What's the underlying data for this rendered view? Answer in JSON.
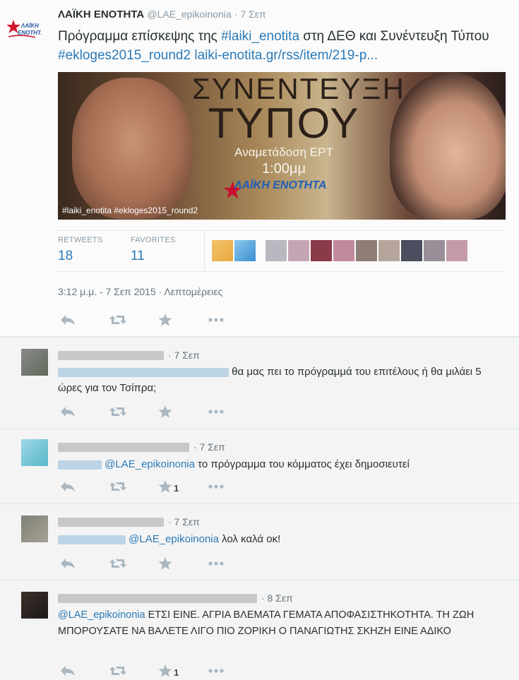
{
  "main": {
    "name": "ΛΑΪΚΗ ΕΝΟΤΗΤΑ",
    "handle": "@LAE_epikoinonia",
    "time": "· 7 Σεπ",
    "text_a": "Πρόγραμμα επίσκεψης της ",
    "hashtag1": "#laiki_enotita",
    "text_b": " στη ΔΕΘ και Συνέντευξη Τύπου ",
    "hashtag2": "#ekloges2015_round2",
    "link": " laiki-enotita.gr/rss/item/219-p...",
    "media": {
      "title1": "ΣΥΝΕΝΤΕΥΞΗ",
      "title2": "ΤΥΠΟΥ",
      "sub1": "Αναμετάδοση ΕΡΤ",
      "sub2": "1:00μμ",
      "logo": "ΛΑΪΚΗ ΕΝΟΤΗΤΑ",
      "tags": "#laiki_enotita #ekloges2015_round2"
    },
    "stats": {
      "retweets_label": "RETWEETS",
      "retweets": "18",
      "favorites_label": "FAVORITES",
      "favorites": "11"
    },
    "timestamp": "3:12 μ.μ. - 7 Σεπ 2015 · Λεπτομέρειες"
  },
  "replies": [
    {
      "time": "· 7 Σεπ",
      "text": "θα μας πει το πρόγραμμά του επιτέλους ή θα μιλάει 5 ώρες για τον Τσίπρα;",
      "fav_count": ""
    },
    {
      "time": "· 7 Σεπ",
      "mention": "@LAE_epikoinonia",
      "text": " το πρόγραμμα του κόμματος έχει δημοσιευτεί",
      "fav_count": "1"
    },
    {
      "time": "· 7 Σεπ",
      "mention": "@LAE_epikoinonia",
      "text": " λολ καλά οκ!",
      "fav_count": ""
    },
    {
      "time": "· 8 Σεπ",
      "mention": "@LAE_epikoinonia",
      "text": " ΕΤΣΙ ΕΙΝΕ. ΑΓΡΙΑ ΒΛΕΜΑΤΑ ΓΕΜΑΤΑ ΑΠΟΦΑΣΙΣΤΗΚΟΤΗΤΑ. ΤΗ ΖΩΗ ΜΠΟΡΟΥΣΑΤΕ ΝΑ ΒΑΛΕΤΕ ΛΙΓΟ ΠΙΟ ΖΟΡΙΚΗ Ο ΠΑΝΑΓΙΩΤΗΣ ΣΚΗΖΗ ΕΙΝΕ ΑΔΙΚΟ",
      "fav_count": "1"
    }
  ],
  "icons": [
    "reply-icon",
    "retweet-icon",
    "favorite-icon",
    "more-icon"
  ],
  "colors": {
    "link": "#2a7ab8",
    "icon": "#aab8c2",
    "muted": "#8899a6"
  }
}
